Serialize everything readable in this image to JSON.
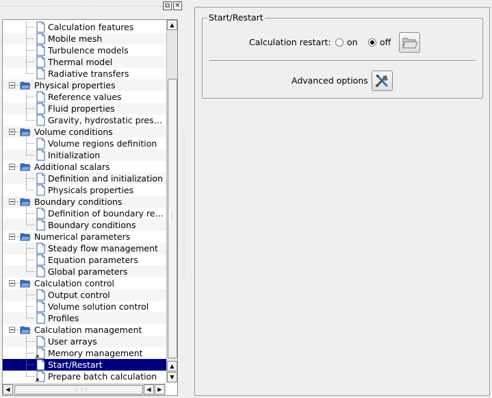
{
  "tree": {
    "items": [
      {
        "label": "Calculation features",
        "level": 1,
        "branch": "mid"
      },
      {
        "label": "Mobile mesh",
        "level": 1,
        "branch": "mid"
      },
      {
        "label": "Turbulence models",
        "level": 1,
        "branch": "mid"
      },
      {
        "label": "Thermal model",
        "level": 1,
        "branch": "mid"
      },
      {
        "label": "Radiative transfers",
        "level": 1,
        "branch": "last"
      },
      {
        "label": "Physical properties",
        "level": 0,
        "expanded": true
      },
      {
        "label": "Reference values",
        "level": 1,
        "branch": "mid"
      },
      {
        "label": "Fluid properties",
        "level": 1,
        "branch": "mid"
      },
      {
        "label": "Gravity, hydrostatic pres…",
        "level": 1,
        "branch": "last"
      },
      {
        "label": "Volume conditions",
        "level": 0,
        "expanded": true
      },
      {
        "label": "Volume regions definition",
        "level": 1,
        "branch": "mid"
      },
      {
        "label": "Initialization",
        "level": 1,
        "branch": "last"
      },
      {
        "label": "Additional scalars",
        "level": 0,
        "expanded": true
      },
      {
        "label": "Definition and initialization",
        "level": 1,
        "branch": "mid"
      },
      {
        "label": "Physicals properties",
        "level": 1,
        "branch": "last"
      },
      {
        "label": "Boundary conditions",
        "level": 0,
        "expanded": true
      },
      {
        "label": "Definition of boundary re…",
        "level": 1,
        "branch": "mid"
      },
      {
        "label": "Boundary conditions",
        "level": 1,
        "branch": "last"
      },
      {
        "label": "Numerical parameters",
        "level": 0,
        "expanded": true
      },
      {
        "label": "Steady flow management",
        "level": 1,
        "branch": "mid"
      },
      {
        "label": "Equation parameters",
        "level": 1,
        "branch": "mid"
      },
      {
        "label": "Global parameters",
        "level": 1,
        "branch": "last"
      },
      {
        "label": "Calculation control",
        "level": 0,
        "expanded": true
      },
      {
        "label": "Output control",
        "level": 1,
        "branch": "mid"
      },
      {
        "label": "Volume solution control",
        "level": 1,
        "branch": "mid"
      },
      {
        "label": "Profiles",
        "level": 1,
        "branch": "last"
      },
      {
        "label": "Calculation management",
        "level": 0,
        "expanded": true
      },
      {
        "label": "User arrays",
        "level": 1,
        "branch": "mid"
      },
      {
        "label": "Memory management",
        "level": 1,
        "branch": "mid",
        "shortcut": true
      },
      {
        "label": "Start/Restart",
        "level": 1,
        "branch": "mid",
        "selected": true
      },
      {
        "label": "Prepare batch calculation",
        "level": 1,
        "branch": "last",
        "shortcut": true
      }
    ]
  },
  "dock": {
    "float_icon": "float-window-icon",
    "close_icon": "close-icon"
  },
  "start_restart": {
    "group_title": "Start/Restart",
    "restart_label": "Calculation restart:",
    "option_on": "on",
    "option_off": "off",
    "selected": "off",
    "open_icon": "open-folder-icon",
    "advanced_label": "Advanced options",
    "advanced_icon": "tools-icon"
  },
  "colors": {
    "selection": "#00007f",
    "folder": "#3a6fc4",
    "background": "#efefef"
  }
}
